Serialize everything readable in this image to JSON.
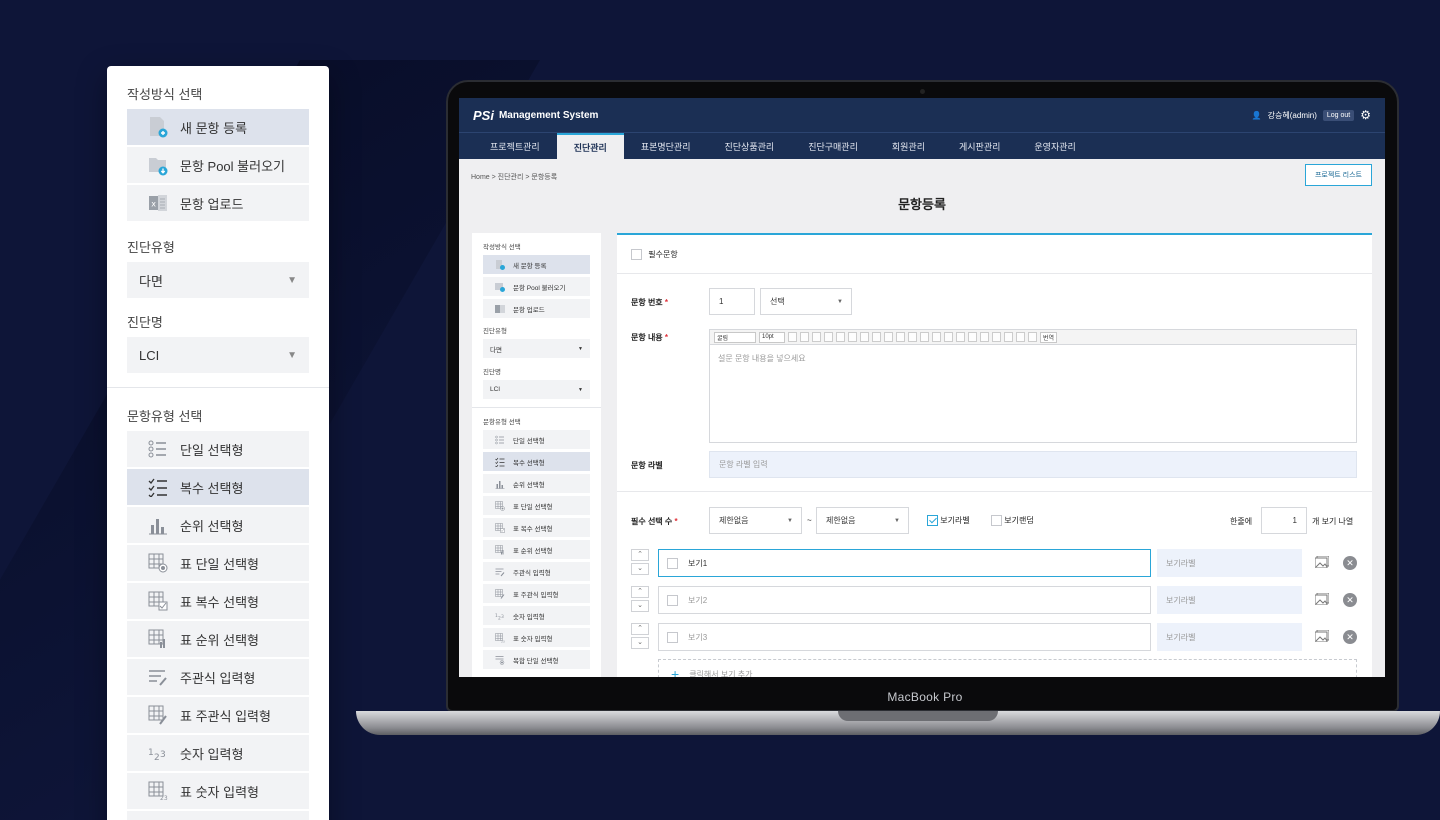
{
  "side_panel": {
    "write_method_label": "작성방식 선택",
    "write_methods": [
      {
        "label": "새 문항 등록",
        "icon": "new-doc-icon",
        "selected": true
      },
      {
        "label": "문항 Pool 불러오기",
        "icon": "folder-download-icon",
        "selected": false
      },
      {
        "label": "문항 업로드",
        "icon": "excel-icon",
        "selected": false
      }
    ],
    "diag_type_label": "진단유형",
    "diag_type_value": "다면",
    "diag_name_label": "진단명",
    "diag_name_value": "LCI",
    "item_type_label": "문항유형 선택",
    "item_types": [
      {
        "label": "단일 선택형",
        "icon": "single-choice-icon",
        "selected": false
      },
      {
        "label": "복수 선택형",
        "icon": "multi-choice-icon",
        "selected": true
      },
      {
        "label": "순위 선택형",
        "icon": "rank-icon",
        "selected": false
      },
      {
        "label": "표 단일 선택형",
        "icon": "table-single-icon",
        "selected": false
      },
      {
        "label": "표 복수 선택형",
        "icon": "table-multi-icon",
        "selected": false
      },
      {
        "label": "표 순위 선택형",
        "icon": "table-rank-icon",
        "selected": false
      },
      {
        "label": "주관식 입력형",
        "icon": "text-input-icon",
        "selected": false
      },
      {
        "label": "표 주관식 입력형",
        "icon": "table-text-icon",
        "selected": false
      },
      {
        "label": "숫자 입력형",
        "icon": "number-input-icon",
        "selected": false
      },
      {
        "label": "표 숫자 입력형",
        "icon": "table-number-icon",
        "selected": false
      },
      {
        "label": "복합 단일 선택형",
        "icon": "complex-single-icon",
        "selected": false
      }
    ]
  },
  "laptop": {
    "label": "MacBook Pro"
  },
  "app": {
    "logo": "PSi",
    "system_name": "Management System",
    "user": "강승혜(admin)",
    "logout": "Log out",
    "nav": [
      {
        "label": "프로젝트관리",
        "active": false
      },
      {
        "label": "진단관리",
        "active": true
      },
      {
        "label": "표본명단관리",
        "active": false
      },
      {
        "label": "진단상품관리",
        "active": false
      },
      {
        "label": "진단구매관리",
        "active": false
      },
      {
        "label": "회원관리",
        "active": false
      },
      {
        "label": "게시판관리",
        "active": false
      },
      {
        "label": "운영자관리",
        "active": false
      }
    ],
    "breadcrumb": "Home > 진단관리 > 문항등록",
    "project_list_btn": "프로젝트 리스트",
    "page_title": "문항등록"
  },
  "form": {
    "required_item": "필수문항",
    "item_no_label": "문항 번호",
    "item_no_value": "1",
    "item_no_select": "선택",
    "content_label": "문항 내용",
    "editor_font": "굴림",
    "editor_size": "10pt",
    "editor_translate": "번역",
    "content_placeholder": "설문 문항 내용을 넣으세요",
    "item_label_label": "문항 라벨",
    "item_label_placeholder": "문항 라벨 입력",
    "required_count_label": "필수 선택 수",
    "min_select": "제한없음",
    "range_sep": "~",
    "max_select": "제한없음",
    "show_label": "보기라벨",
    "show_label_checked": true,
    "show_random": "보기랜덤",
    "per_line_prefix": "한줄에",
    "per_line_value": "1",
    "per_line_suffix": "개 보기 나열",
    "options": [
      {
        "label": "보기1",
        "label_placeholder": "보기라벨",
        "focused": true
      },
      {
        "label": "보기2",
        "label_placeholder": "보기라벨",
        "focused": false
      },
      {
        "label": "보기3",
        "label_placeholder": "보기라벨",
        "focused": false
      }
    ],
    "add_option": "클릭해서 보기 추가"
  }
}
